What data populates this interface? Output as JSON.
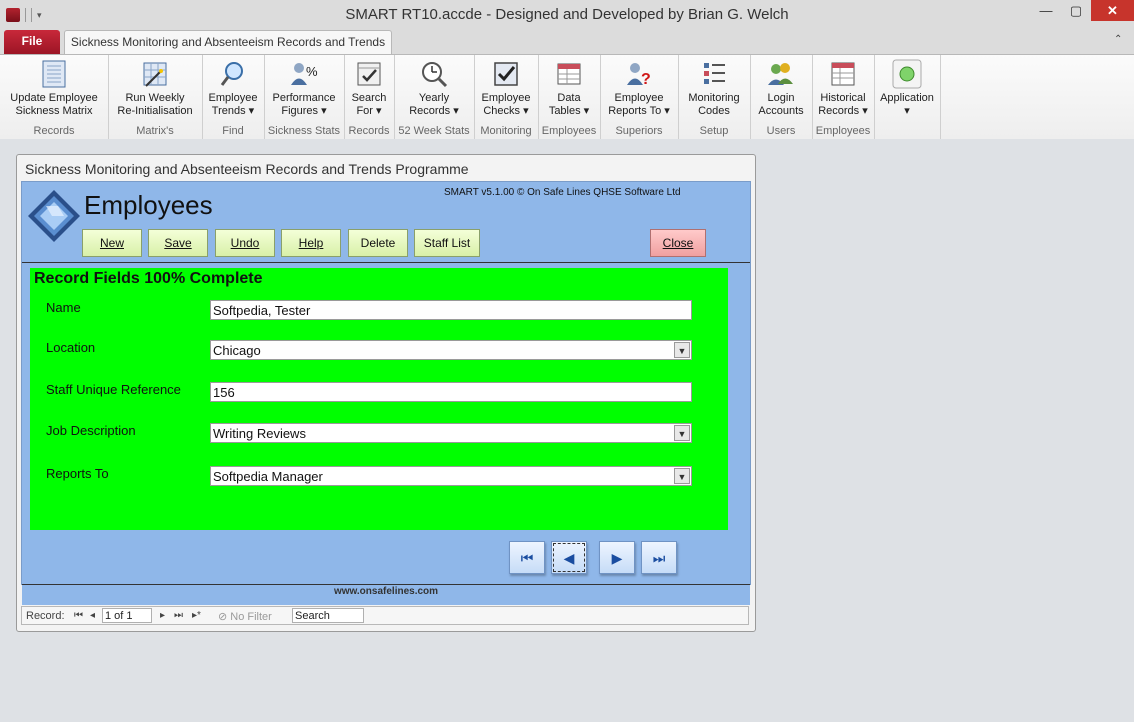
{
  "window": {
    "title": "SMART RT10.accde - Designed and Developed by Brian G. Welch",
    "min": "—",
    "max": "▢",
    "close": "✕"
  },
  "ribbon": {
    "file_tab": "File",
    "main_tab": "Sickness Monitoring and Absenteeism Records and Trends",
    "groups": [
      {
        "buttons": [
          {
            "line1": "Update Employee",
            "line2": "Sickness Matrix"
          }
        ],
        "label": "Records"
      },
      {
        "buttons": [
          {
            "line1": "Run Weekly",
            "line2": "Re-Initialisation"
          }
        ],
        "label": "Matrix's"
      },
      {
        "buttons": [
          {
            "line1": "Employee",
            "line2": "Trends ▾"
          }
        ],
        "label": "Find"
      },
      {
        "buttons": [
          {
            "line1": "Performance",
            "line2": "Figures ▾"
          }
        ],
        "label": "Sickness Stats"
      },
      {
        "buttons": [
          {
            "line1": "Search",
            "line2": "For ▾"
          }
        ],
        "label": "Records"
      },
      {
        "buttons": [
          {
            "line1": "Yearly",
            "line2": "Records ▾"
          }
        ],
        "label": "52 Week Stats"
      },
      {
        "buttons": [
          {
            "line1": "Employee",
            "line2": "Checks ▾"
          }
        ],
        "label": "Monitoring"
      },
      {
        "buttons": [
          {
            "line1": "Data",
            "line2": "Tables ▾"
          }
        ],
        "label": "Employees"
      },
      {
        "buttons": [
          {
            "line1": "Employee",
            "line2": "Reports To ▾"
          }
        ],
        "label": "Superiors"
      },
      {
        "buttons": [
          {
            "line1": "Monitoring",
            "line2": "Codes"
          }
        ],
        "label": "Setup"
      },
      {
        "buttons": [
          {
            "line1": "Login",
            "line2": "Accounts"
          }
        ],
        "label": "Users"
      },
      {
        "buttons": [
          {
            "line1": "Historical",
            "line2": "Records ▾"
          }
        ],
        "label": "Employees"
      },
      {
        "buttons": [
          {
            "line1": "Application",
            "line2": "▾"
          }
        ],
        "label": ""
      }
    ]
  },
  "form": {
    "window_title": "Sickness Monitoring and Absenteeism Records and Trends Programme",
    "heading": "Employees",
    "copyright": "SMART v5.1.00 © On Safe Lines QHSE Software Ltd",
    "buttons": {
      "new": "New",
      "save": "Save",
      "undo": "Undo",
      "help": "Help",
      "delete": "Delete",
      "staff_list": "Staff List",
      "close": "Close"
    },
    "panel_title": "Record Fields 100% Complete",
    "fields": {
      "name_label": "Name",
      "name_value": "Softpedia, Tester",
      "location_label": "Location",
      "location_value": "Chicago",
      "ref_label": "Staff Unique Reference",
      "ref_value": "156",
      "job_label": "Job Description",
      "job_value": "Writing Reviews",
      "reports_label": "Reports To",
      "reports_value": "Softpedia Manager"
    },
    "nav": {
      "first": "⏮",
      "prev": "◀",
      "next": "▶",
      "last": "⏭"
    },
    "footer_url": "www.onsafelines.com"
  },
  "recordbar": {
    "label": "Record:",
    "first": "⏮",
    "prev": "◂",
    "current": "1 of 1",
    "next": "▸",
    "last": "⏭",
    "new": "▸*",
    "filter": "No Filter",
    "search": "Search"
  },
  "colors": {
    "panel_complete": "#00ff00",
    "form_background": "#8fb7e9",
    "close_button": "#f0a0a0",
    "file_tab": "#b31d2e"
  }
}
